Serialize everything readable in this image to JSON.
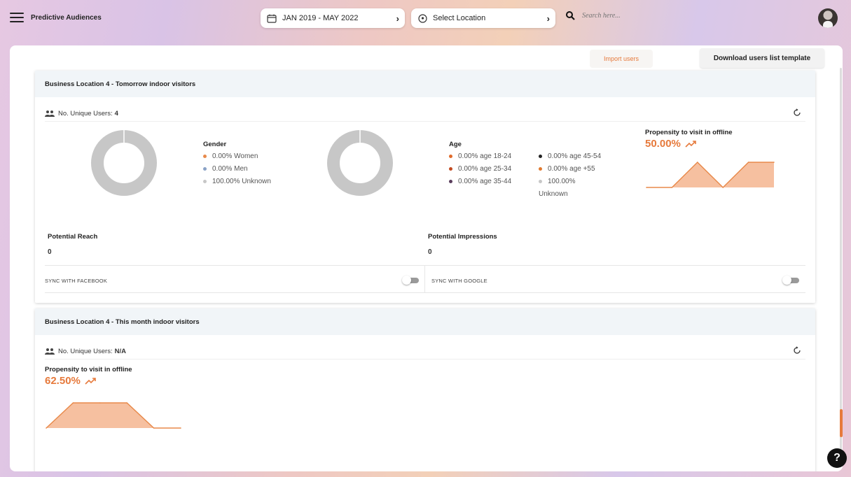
{
  "app": {
    "title": "Predictive Audiences"
  },
  "header": {
    "date_range": "JAN 2019 - MAY 2022",
    "location": "Select Location",
    "search_placeholder": "Search here..."
  },
  "actions": {
    "import": "Import users",
    "template": "Download users list template"
  },
  "cards": [
    {
      "title": "Business Location 4 - Tomorrow indoor visitors",
      "users_label": "No. Unique Users:",
      "users_value": "4",
      "gender": {
        "title": "Gender",
        "items": [
          {
            "label": "0.00% Women",
            "color": "#e8894a"
          },
          {
            "label": "0.00% Men",
            "color": "#8aa2c6"
          },
          {
            "label": "100.00% Unknown",
            "color": "#c7c7c7"
          }
        ]
      },
      "age": {
        "title": "Age",
        "items": [
          {
            "label": "0.00% age 18-24",
            "color": "#e06a2a"
          },
          {
            "label": "0.00% age 25-34",
            "color": "#c24a20"
          },
          {
            "label": "0.00% age 35-44",
            "color": "#5a3d5c"
          },
          {
            "label": "0.00% age 45-54",
            "color": "#222222"
          },
          {
            "label": "0.00% age +55",
            "color": "#e07a30"
          },
          {
            "label": "100.00%",
            "color": "#c7c7c7"
          },
          {
            "label": "Unknown"
          }
        ]
      },
      "propensity": {
        "title": "Propensity to visit in offline",
        "value": "50.00%"
      },
      "reach": {
        "label": "Potential Reach",
        "value": "0"
      },
      "impressions": {
        "label": "Potential Impressions",
        "value": "0"
      },
      "sync_facebook": "SYNC WITH FACEBOOK",
      "sync_google": "SYNC WITH GOOGLE"
    },
    {
      "title": "Business Location 4 - This month indoor visitors",
      "users_label": "No. Unique Users:",
      "users_value": "N/A",
      "propensity": {
        "title": "Propensity to visit in offline",
        "value": "62.50%"
      }
    }
  ],
  "help": "?",
  "chart_data": [
    {
      "type": "area",
      "x": [
        0,
        1,
        2,
        3,
        4,
        5
      ],
      "values": [
        0,
        0,
        1,
        0,
        1,
        1
      ],
      "color": "#e8894a"
    },
    {
      "type": "area",
      "x": [
        0,
        1,
        2,
        3,
        4,
        5
      ],
      "values": [
        0,
        1,
        1,
        1,
        0,
        0
      ],
      "color": "#e8894a"
    }
  ]
}
